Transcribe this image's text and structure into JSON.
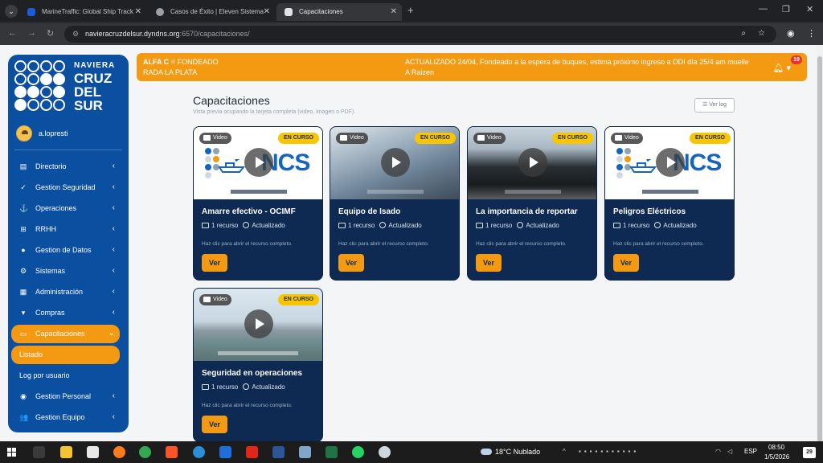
{
  "browser": {
    "tabs": [
      {
        "title": "MarineTraffic: Global Ship Track",
        "active": false
      },
      {
        "title": "Casos de Éxito | Eleven Sistema",
        "active": false
      },
      {
        "title": "Capacitaciones",
        "active": true
      }
    ],
    "new_tab": "+",
    "url_host": "navieracruzdelsur.dyndns.org",
    "url_rest": ":6570/capacitaciones/"
  },
  "brand": {
    "line1": "NAVIERA",
    "line2": "CRUZ",
    "line3": "DEL",
    "line4": "SUR"
  },
  "user": {
    "name": "a.lopresti"
  },
  "sidebar": {
    "items": [
      {
        "label": "Directorio",
        "icon": "book-icon"
      },
      {
        "label": "Gestion Seguridad",
        "icon": "clipboard-check-icon"
      },
      {
        "label": "Operaciones",
        "icon": "anchor-icon"
      },
      {
        "label": "RRHH",
        "icon": "sitemap-icon"
      },
      {
        "label": "Gestion de Datos",
        "icon": "database-icon"
      },
      {
        "label": "Sistemas",
        "icon": "cogs-icon"
      },
      {
        "label": "Administración",
        "icon": "building-icon"
      },
      {
        "label": "Compras",
        "icon": "cart-icon"
      },
      {
        "label": "Capacitaciones",
        "icon": "chalkboard-icon"
      },
      {
        "label": "Listado"
      },
      {
        "label": "Log por usuario"
      },
      {
        "label": "Gestion Personal",
        "icon": "user-circle-icon"
      },
      {
        "label": "Gestion Equipo",
        "icon": "users-icon"
      }
    ]
  },
  "banner": {
    "vessel": "ALFA C",
    "status": "FONDEADO",
    "location": "RADA LA PLATA",
    "update_line1": "ACTUALIZADO 24/04, Fondeado a la espera de buques, estima próximo ingreso a DDI día 25/4 am muelle",
    "update_line2": "A Raizen",
    "notifications": "19"
  },
  "page": {
    "title": "Capacitaciones",
    "subtitle": "Vista previa ocupando la tarjeta completa (video, imagen o PDF).",
    "log_button": "Ver log"
  },
  "cards": [
    {
      "title": "Amarre efectivo - OCIMF",
      "type": "Video",
      "status": "EN CURSO",
      "resources": "1 recurso",
      "updated": "Actualizado",
      "hint": "Haz clic para abrir el recurso completo.",
      "button": "Ver",
      "media": "ncs-logo"
    },
    {
      "title": "Equipo de Isado",
      "type": "Video",
      "status": "EN CURSO",
      "resources": "1 recurso",
      "updated": "Actualizado",
      "hint": "Haz clic para abrir el recurso completo.",
      "button": "Ver",
      "media": "photo"
    },
    {
      "title": "La importancia de reportar",
      "type": "Video",
      "status": "EN CURSO",
      "resources": "1 recurso",
      "updated": "Actualizado",
      "hint": "Haz clic para abrir el recurso completo.",
      "button": "Ver",
      "media": "photo"
    },
    {
      "title": "Peligros Eléctricos",
      "type": "Video",
      "status": "EN CURSO",
      "resources": "1 recurso",
      "updated": "Actualizado",
      "hint": "Haz clic para abrir el recurso completo.",
      "button": "Ver",
      "media": "ncs-logo"
    },
    {
      "title": "Seguridad en operaciones",
      "type": "Video",
      "status": "EN CURSO",
      "resources": "1 recurso",
      "updated": "Actualizado",
      "hint": "Haz clic para abrir el recurso completo.",
      "button": "Ver",
      "media": "photo"
    }
  ],
  "ncs": {
    "word": "NCS"
  },
  "taskbar": {
    "weather": "18°C  Nublado",
    "lang": "ESP",
    "time": "08:50",
    "date": "1/5/2026",
    "notif": "29"
  },
  "colors": {
    "sidebar": "#0b4fa0",
    "accent": "#f39a12",
    "card": "#0e2a52",
    "status_chip": "#f7c600"
  }
}
